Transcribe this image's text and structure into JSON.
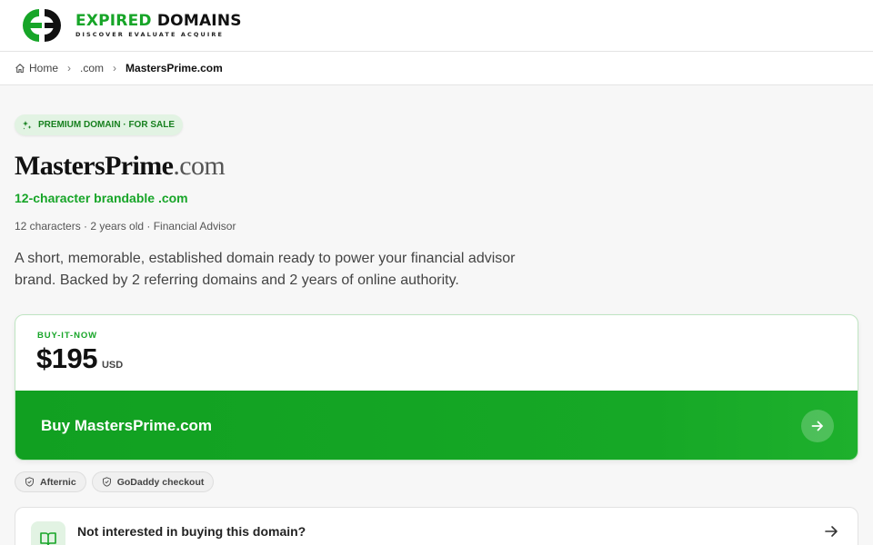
{
  "header": {
    "logo_word_green": "EXPIRED",
    "logo_word_dark": "DOMAINS",
    "logo_tagline": "DISCOVER EVALUATE ACQUIRE",
    "logo_icon": "ed-logo-icon"
  },
  "breadcrumb": {
    "home_icon": "home-icon",
    "items": [
      "Home",
      ".com",
      "MastersPrime.com"
    ]
  },
  "badge": {
    "icon": "sparkle-icon",
    "label": "PREMIUM DOMAIN · FOR SALE"
  },
  "domain": {
    "name": "MastersPrime",
    "tld": ".com",
    "subtitle": "12-character brandable .com",
    "meta": "12 characters · 2 years old · Financial Advisor",
    "description": "A short, memorable, established domain ready to power your financial advisor brand. Backed by 2 referring domains and 2 years of online authority."
  },
  "buy_card": {
    "label": "BUY-IT-NOW",
    "price": "$195",
    "currency": "USD",
    "button_label": "Buy MastersPrime.com",
    "button_icon": "arrow-right-icon"
  },
  "chips": [
    {
      "icon": "shield-check-icon",
      "label": "Afternic"
    },
    {
      "icon": "shield-check-icon",
      "label": "GoDaddy checkout"
    }
  ],
  "not_interested": {
    "icon": "book-open-icon",
    "label": "Not interested in buying this domain?",
    "arrow_icon": "arrow-right-icon"
  },
  "colors": {
    "brand_green": "#17a528",
    "button_green": "#11a021",
    "badge_bg": "#e2f3e3",
    "page_bg": "#f7f7f7"
  }
}
